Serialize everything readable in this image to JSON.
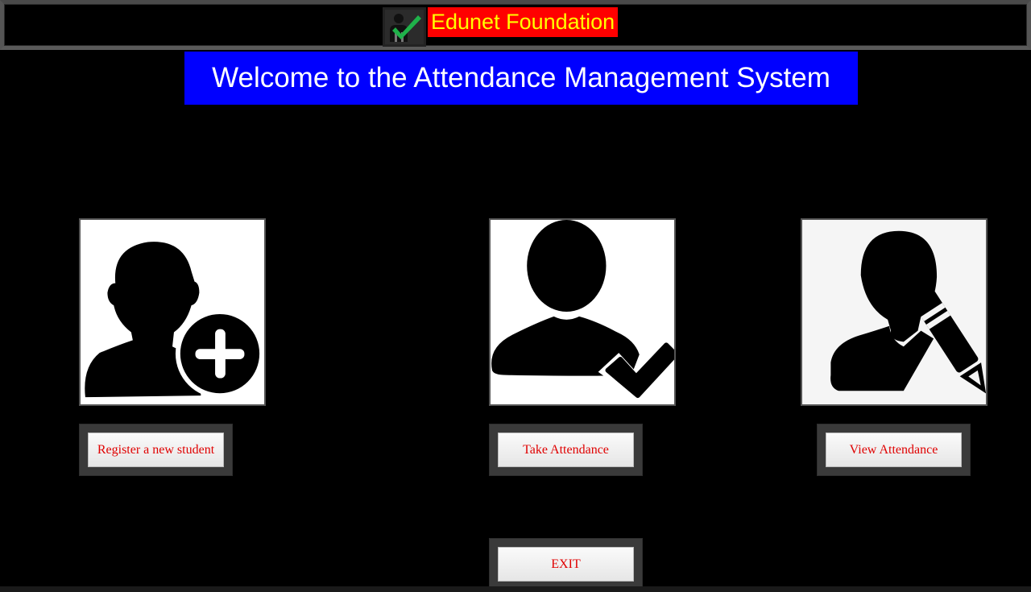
{
  "window": {
    "title": "Edunet Foundation",
    "icon": "attendance-check-icon"
  },
  "banner": {
    "text": "Welcome to the Attendance Management System"
  },
  "tiles": [
    {
      "icon": "user-add-icon"
    },
    {
      "icon": "user-check-icon"
    },
    {
      "icon": "user-edit-icon"
    }
  ],
  "buttons": {
    "register": "Register a new student",
    "take": "Take Attendance",
    "view": "View Attendance",
    "exit": "EXIT"
  },
  "colors": {
    "background": "#000000",
    "title_bg": "#ff0000",
    "title_text": "#ffff00",
    "banner_bg": "#0000ff",
    "banner_text": "#ffffff",
    "button_text": "#e00000"
  }
}
